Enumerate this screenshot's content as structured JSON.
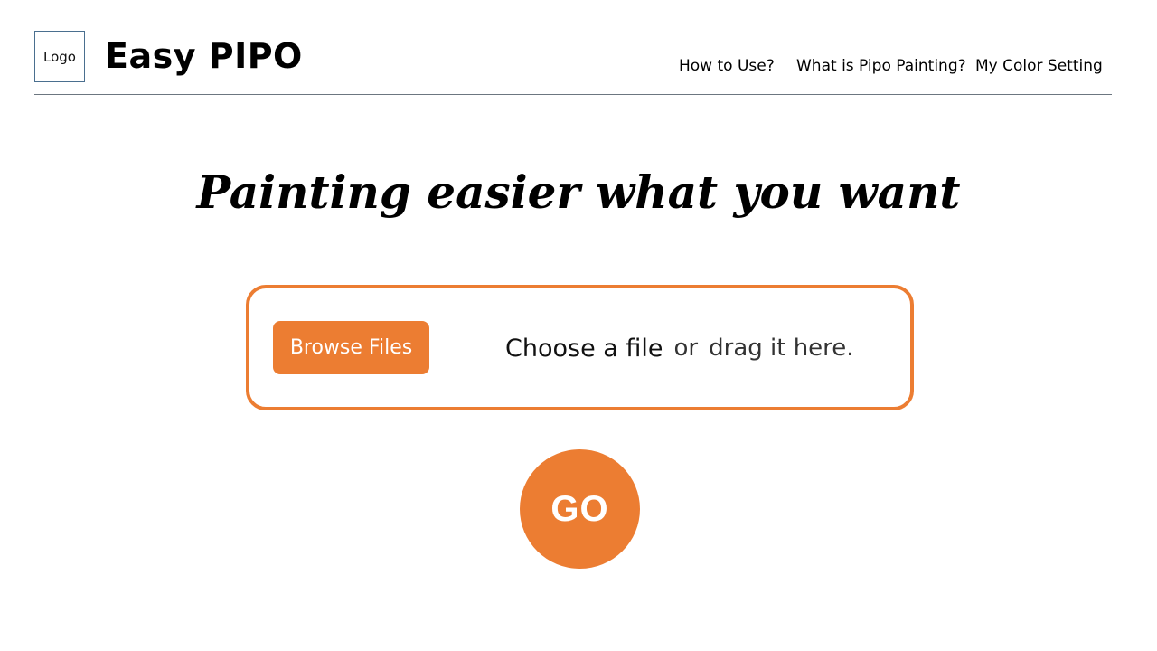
{
  "header": {
    "logo_label": "Logo",
    "brand": "Easy PIPO",
    "nav": [
      {
        "label": "How to Use?"
      },
      {
        "label": "What is Pipo Painting?"
      },
      {
        "label": "My Color Setting"
      }
    ]
  },
  "hero": {
    "title": "Painting easier what you want"
  },
  "upload": {
    "browse_label": "Browse Files",
    "choose_text": "Choose a file",
    "or_text": "or",
    "drag_text": "drag it here."
  },
  "actions": {
    "go_label": "GO"
  },
  "colors": {
    "accent": "#ec7d32",
    "logo_border": "#4a6f8f",
    "rule": "#6c7680"
  }
}
